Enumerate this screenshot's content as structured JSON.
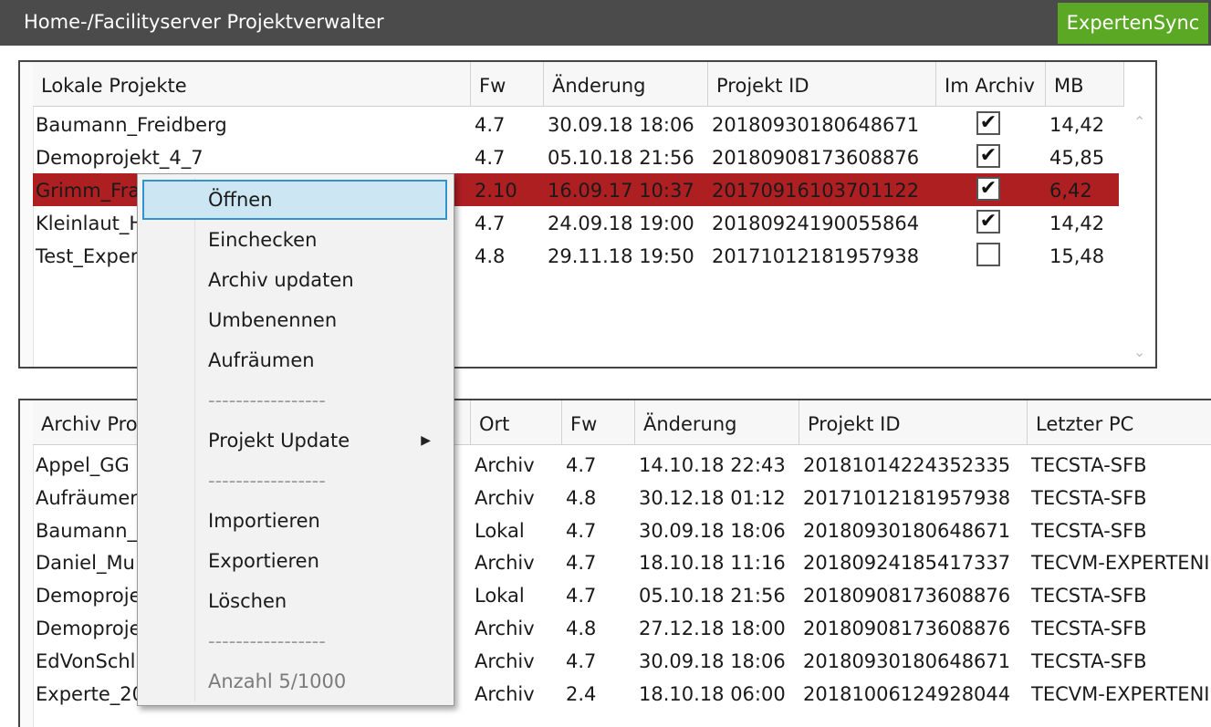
{
  "window": {
    "title": "Home-/Facilityserver Projektverwalter",
    "sync_button": "ExpertenSync"
  },
  "local_table": {
    "columns": [
      "Lokale Projekte",
      "Fw",
      "Änderung",
      "Projekt ID",
      "Im Archiv",
      "MB"
    ],
    "rows": [
      {
        "name": "Baumann_Freidberg",
        "fw": "4.7",
        "changed": "30.09.18 18:06",
        "id": "20180930180648671",
        "archived": true,
        "mb": "14,42"
      },
      {
        "name": "Demoprojekt_4_7",
        "fw": "4.7",
        "changed": "05.10.18 21:56",
        "id": "20180908173608876",
        "archived": true,
        "mb": "45,85"
      },
      {
        "name": "Grimm_Fra",
        "fw": "2.10",
        "changed": "16.09.17 10:37",
        "id": "20170916103701122",
        "archived": true,
        "mb": "6,42",
        "selected": true
      },
      {
        "name": "Kleinlaut_H",
        "fw": "4.7",
        "changed": "24.09.18 19:00",
        "id": "20180924190055864",
        "archived": true,
        "mb": "14,42"
      },
      {
        "name": "Test_Exper",
        "fw": "4.8",
        "changed": "29.11.18 19:50",
        "id": "20171012181957938",
        "archived": false,
        "mb": "15,48"
      }
    ],
    "scroll_up_icon": "chevron-up-icon",
    "scroll_down_icon": "chevron-down-icon"
  },
  "archive_table": {
    "columns": [
      "Archiv Pro",
      "Ort",
      "Fw",
      "Änderung",
      "Projekt ID",
      "Letzter PC"
    ],
    "rows": [
      {
        "name": "Appel_GG",
        "ort": "Archiv",
        "fw": "4.7",
        "changed": "14.10.18 22:43",
        "id": "20181014224352335",
        "pc": "TECSTA-SFB"
      },
      {
        "name": "Aufräumer",
        "ort": "Archiv",
        "fw": "4.8",
        "changed": "30.12.18 01:12",
        "id": "20171012181957938",
        "pc": "TECSTA-SFB"
      },
      {
        "name": "Baumann_",
        "ort": "Lokal",
        "fw": "4.7",
        "changed": "30.09.18 18:06",
        "id": "20180930180648671",
        "pc": "TECSTA-SFB"
      },
      {
        "name": "Daniel_Mu",
        "ort": "Archiv",
        "fw": "4.7",
        "changed": "18.10.18 11:16",
        "id": "20180924185417337",
        "pc": "TECVM-EXPERTENI"
      },
      {
        "name": "Demoproje",
        "ort": "Lokal",
        "fw": "4.7",
        "changed": "05.10.18 21:56",
        "id": "20180908173608876",
        "pc": "TECSTA-SFB"
      },
      {
        "name": "Demoproje",
        "ort": "Archiv",
        "fw": "4.8",
        "changed": "27.12.18 18:00",
        "id": "20180908173608876",
        "pc": "TECSTA-SFB"
      },
      {
        "name": "EdVonSchl",
        "ort": "Archiv",
        "fw": "4.7",
        "changed": "30.09.18 18:06",
        "id": "20180930180648671",
        "pc": "TECSTA-SFB"
      },
      {
        "name": "Experte_20",
        "ort": "Archiv",
        "fw": "2.4",
        "changed": "18.10.18 06:00",
        "id": "20181006124928044",
        "pc": "TECVM-EXPERTENI"
      }
    ]
  },
  "context_menu": {
    "items": [
      {
        "label": "Öffnen",
        "state": "hover"
      },
      {
        "label": "Einchecken"
      },
      {
        "label": "Archiv updaten"
      },
      {
        "label": "Umbenennen"
      },
      {
        "label": "Aufräumen"
      },
      {
        "label": "-----------------",
        "state": "separator"
      },
      {
        "label": "Projekt Update",
        "submenu": true
      },
      {
        "label": "-----------------",
        "state": "separator"
      },
      {
        "label": "Importieren"
      },
      {
        "label": "Exportieren"
      },
      {
        "label": "Löschen"
      },
      {
        "label": "-----------------",
        "state": "separator"
      },
      {
        "label": "Anzahl 5/1000",
        "state": "disabled"
      }
    ],
    "submenu_icon": "triangle-right-icon"
  }
}
